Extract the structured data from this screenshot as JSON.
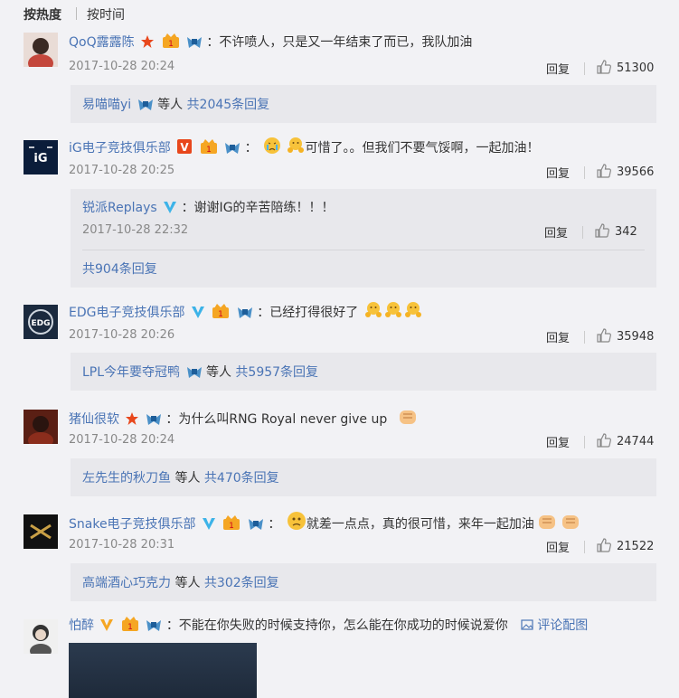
{
  "tabs": {
    "hot": "按热度",
    "time": "按时间"
  },
  "reply_label": "回复",
  "others_label": "等人",
  "comments": [
    {
      "user": "QoQ露露陈",
      "text": "：不许喷人，只是又一年结束了而已，我队加油",
      "time": "2017-10-28 20:24",
      "likes": "51300",
      "sub": {
        "user": "易喵喵yi",
        "more": "共2045条回复"
      }
    },
    {
      "user": "iG电子竞技俱乐部",
      "text": "可惜了。。但我们不要气馁啊，一起加油！",
      "time": "2017-10-28 20:25",
      "likes": "39566",
      "reply": {
        "user": "锐派Replays",
        "text": "：谢谢IG的辛苦陪练！！！",
        "time": "2017-10-28 22:32",
        "likes": "342"
      },
      "more": "共904条回复"
    },
    {
      "user": "EDG电子竞技俱乐部",
      "text": "：已经打得很好了",
      "time": "2017-10-28 20:26",
      "likes": "35948",
      "sub": {
        "user": "LPL今年要夺冠鸭",
        "more": "共5957条回复"
      }
    },
    {
      "user": "猪仙很软",
      "text": "：为什么叫RNG Royal never give up",
      "time": "2017-10-28 20:24",
      "likes": "24744",
      "sub": {
        "user": "左先生的秋刀鱼",
        "more": "共470条回复"
      }
    },
    {
      "user": "Snake电子竞技俱乐部",
      "text": "就差一点点，真的很可惜，来年一起加油",
      "time": "2017-10-28 20:31",
      "likes": "21522",
      "sub": {
        "user": "高端酒心巧克力",
        "more": "共302条回复"
      }
    },
    {
      "user": "怕醉",
      "text": "：不能在你失败的时候支持你，怎么能在你成功的时候说爱你",
      "pic_link": "评论配图"
    }
  ],
  "colors": {
    "link": "#4a74b5",
    "text": "#333333",
    "time": "#888888",
    "background": "#f2f2f5",
    "subbox": "#e8e8ec",
    "vip": "#e8471c",
    "verified": "#3db3e8"
  },
  "icons": [
    "star-badge-icon",
    "vip-v-badge-icon",
    "verified-v-icon",
    "crown-badge-icon",
    "team-badge-icon",
    "thumbs-up-icon",
    "image-icon"
  ]
}
